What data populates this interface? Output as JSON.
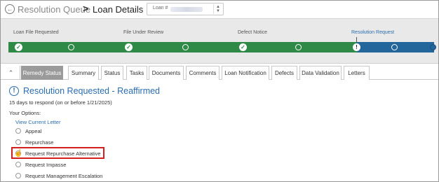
{
  "header": {
    "back_icon": "circle-arrow-left-icon",
    "breadcrumb_parent": "Resolution Queue",
    "breadcrumb_separator": ">",
    "breadcrumb_current": "Loan Details",
    "loan_selector_label": "Loan #",
    "loan_selector_chevrons_icon": "chevron-up-down-icon"
  },
  "progress": {
    "stages": [
      {
        "label": "Loan File Requested",
        "state": "complete"
      },
      {
        "label": "File Under Review",
        "state": "complete"
      },
      {
        "label": "Defect Notice",
        "state": "complete"
      },
      {
        "label": "Resolution Request",
        "state": "current"
      }
    ],
    "colors": {
      "complete": "#2f8a47",
      "current": "#23669b"
    }
  },
  "tabs": {
    "collapse_icon": "chevron-up-icon",
    "items": [
      {
        "label": "Remedy Status",
        "active": true
      },
      {
        "label": "Summary"
      },
      {
        "label": "Status"
      },
      {
        "label": "Tasks"
      },
      {
        "label": "Documents"
      },
      {
        "label": "Comments"
      },
      {
        "label": "Loan Notification"
      },
      {
        "label": "Defects"
      },
      {
        "label": "Data Validation"
      },
      {
        "label": "Letters"
      }
    ]
  },
  "content": {
    "status_icon": "exclamation-circle-icon",
    "status_title": "Resolution Requested - Reaffirmed",
    "deadline_text": "15 days to respond (on or before 1/21/2025)",
    "options_label": "Your Options:",
    "view_letter_link": "View Current Letter",
    "options": [
      {
        "label": "Appeal"
      },
      {
        "label": "Repurchase"
      },
      {
        "label": "Request Repurchase Alternative",
        "highlighted": true
      },
      {
        "label": "Request Impasse"
      },
      {
        "label": "Request Management Escalation"
      }
    ],
    "highlight_color": "#d41f1f"
  }
}
